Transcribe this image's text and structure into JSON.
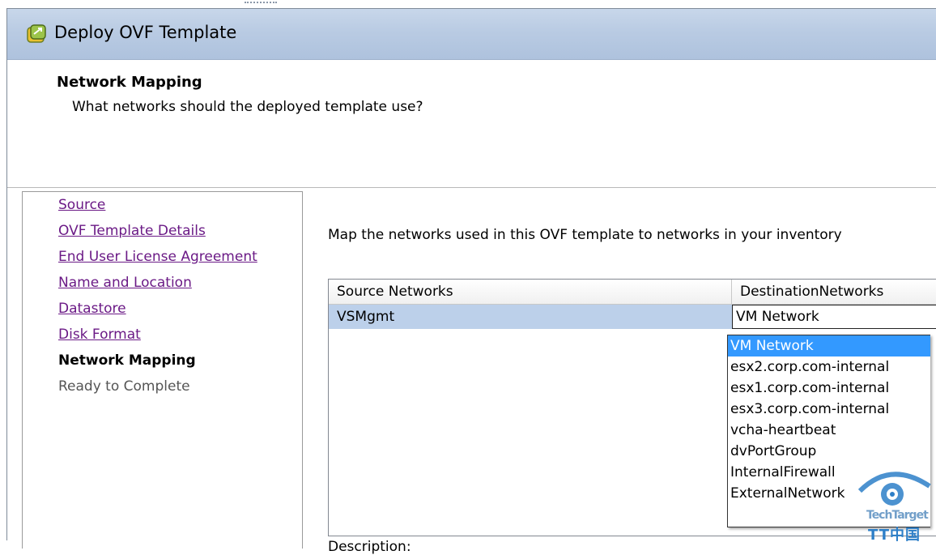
{
  "window": {
    "title": "Deploy OVF Template"
  },
  "header": {
    "step_title": "Network Mapping",
    "step_description": "What networks should the deployed template use?"
  },
  "nav": {
    "items": [
      {
        "label": "Source",
        "state": "completed"
      },
      {
        "label": "OVF Template Details",
        "state": "completed"
      },
      {
        "label": "End User License Agreement",
        "state": "completed"
      },
      {
        "label": "Name and Location",
        "state": "completed"
      },
      {
        "label": "Datastore",
        "state": "completed"
      },
      {
        "label": "Disk Format",
        "state": "completed"
      },
      {
        "label": "Network Mapping",
        "state": "current"
      },
      {
        "label": "Ready to Complete",
        "state": "pending"
      }
    ]
  },
  "main": {
    "instruction": "Map the networks used in this OVF template to networks in your inventory",
    "table": {
      "columns": [
        "Source Networks",
        "DestinationNetworks"
      ],
      "rows": [
        {
          "source": "VSMgmt",
          "destination": "VM Network"
        }
      ]
    },
    "dropdown": {
      "selected": "VM Network",
      "options": [
        "VM Network",
        "esx2.corp.com-internal",
        "esx1.corp.com-internal",
        "esx3.corp.com-internal",
        "vcha-heartbeat",
        "dvPortGroup",
        "InternalFirewall",
        "ExternalNetwork"
      ]
    },
    "description_label": "Description:"
  },
  "watermark": {
    "line1": "TechTarget",
    "line2": "TT中国"
  },
  "colors": {
    "link": "#6b1a86",
    "selection_row": "#bcd0ea",
    "dropdown_highlight": "#3399ff",
    "titlebar": "#b9cbe3"
  }
}
